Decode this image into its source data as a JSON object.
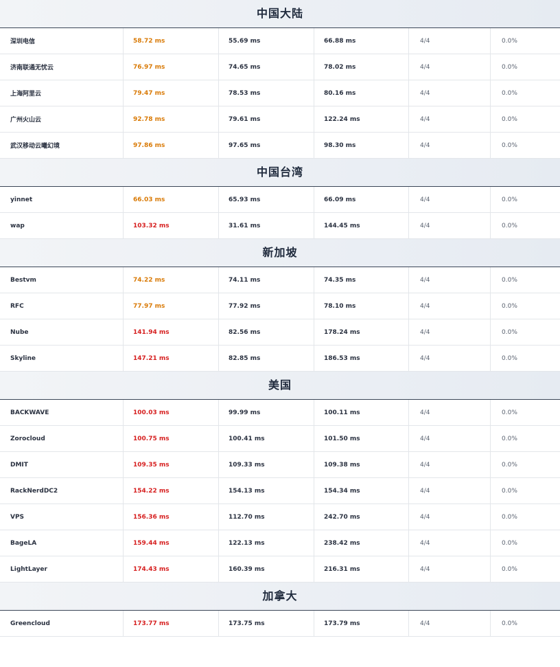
{
  "colors": {
    "orange": "#d97a06",
    "red": "#d61f1f",
    "header_bg": "#eef1f5",
    "text": "#2a3140"
  },
  "groups": [
    {
      "title": "中国大陆",
      "rows": [
        {
          "name": "深圳电信",
          "avg": "58.72 ms",
          "avg_level": "orange",
          "min": "55.69 ms",
          "max": "66.88 ms",
          "received": "4/4",
          "loss": "0.0%"
        },
        {
          "name": "济南联通无忧云",
          "avg": "76.97 ms",
          "avg_level": "orange",
          "min": "74.65 ms",
          "max": "78.02 ms",
          "received": "4/4",
          "loss": "0.0%"
        },
        {
          "name": "上海阿里云",
          "avg": "79.47 ms",
          "avg_level": "orange",
          "min": "78.53 ms",
          "max": "80.16 ms",
          "received": "4/4",
          "loss": "0.0%"
        },
        {
          "name": "广州火山云",
          "avg": "92.78 ms",
          "avg_level": "orange",
          "min": "79.61 ms",
          "max": "122.24 ms",
          "received": "4/4",
          "loss": "0.0%"
        },
        {
          "name": "武汉移动云曦幻境",
          "avg": "97.86 ms",
          "avg_level": "orange",
          "min": "97.65 ms",
          "max": "98.30 ms",
          "received": "4/4",
          "loss": "0.0%"
        }
      ]
    },
    {
      "title": "中国台湾",
      "rows": [
        {
          "name": "yinnet",
          "avg": "66.03 ms",
          "avg_level": "orange",
          "min": "65.93 ms",
          "max": "66.09 ms",
          "received": "4/4",
          "loss": "0.0%"
        },
        {
          "name": "wap",
          "avg": "103.32 ms",
          "avg_level": "red",
          "min": "31.61 ms",
          "max": "144.45 ms",
          "received": "4/4",
          "loss": "0.0%"
        }
      ]
    },
    {
      "title": "新加坡",
      "rows": [
        {
          "name": "Bestvm",
          "avg": "74.22 ms",
          "avg_level": "orange",
          "min": "74.11 ms",
          "max": "74.35 ms",
          "received": "4/4",
          "loss": "0.0%"
        },
        {
          "name": "RFC",
          "avg": "77.97 ms",
          "avg_level": "orange",
          "min": "77.92 ms",
          "max": "78.10 ms",
          "received": "4/4",
          "loss": "0.0%"
        },
        {
          "name": "Nube",
          "avg": "141.94 ms",
          "avg_level": "red",
          "min": "82.56 ms",
          "max": "178.24 ms",
          "received": "4/4",
          "loss": "0.0%"
        },
        {
          "name": "Skyline",
          "avg": "147.21 ms",
          "avg_level": "red",
          "min": "82.85 ms",
          "max": "186.53 ms",
          "received": "4/4",
          "loss": "0.0%"
        }
      ]
    },
    {
      "title": "美国",
      "rows": [
        {
          "name": "BACKWAVE",
          "avg": "100.03 ms",
          "avg_level": "red",
          "min": "99.99 ms",
          "max": "100.11 ms",
          "received": "4/4",
          "loss": "0.0%"
        },
        {
          "name": "Zorocloud",
          "avg": "100.75 ms",
          "avg_level": "red",
          "min": "100.41 ms",
          "max": "101.50 ms",
          "received": "4/4",
          "loss": "0.0%"
        },
        {
          "name": "DMIT",
          "avg": "109.35 ms",
          "avg_level": "red",
          "min": "109.33 ms",
          "max": "109.38 ms",
          "received": "4/4",
          "loss": "0.0%"
        },
        {
          "name": "RackNerdDC2",
          "avg": "154.22 ms",
          "avg_level": "red",
          "min": "154.13 ms",
          "max": "154.34 ms",
          "received": "4/4",
          "loss": "0.0%"
        },
        {
          "name": "VPS",
          "avg": "156.36 ms",
          "avg_level": "red",
          "min": "112.70 ms",
          "max": "242.70 ms",
          "received": "4/4",
          "loss": "0.0%"
        },
        {
          "name": "BageLA",
          "avg": "159.44 ms",
          "avg_level": "red",
          "min": "122.13 ms",
          "max": "238.42 ms",
          "received": "4/4",
          "loss": "0.0%"
        },
        {
          "name": "LightLayer",
          "avg": "174.43 ms",
          "avg_level": "red",
          "min": "160.39 ms",
          "max": "216.31 ms",
          "received": "4/4",
          "loss": "0.0%"
        }
      ]
    },
    {
      "title": "加拿大",
      "rows": [
        {
          "name": "Greencloud",
          "avg": "173.77 ms",
          "avg_level": "red",
          "min": "173.75 ms",
          "max": "173.79 ms",
          "received": "4/4",
          "loss": "0.0%"
        }
      ]
    }
  ]
}
